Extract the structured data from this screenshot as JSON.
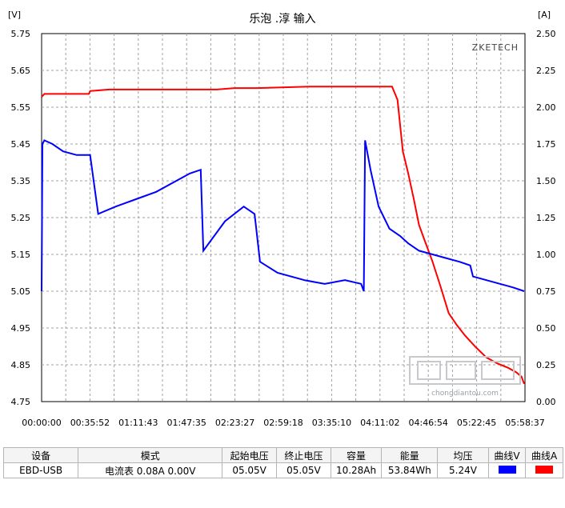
{
  "chart_data": {
    "type": "line",
    "title": "乐泡 .淳 输入",
    "brand": "ZKETECH",
    "left_axis": {
      "label": "[V]",
      "ylim": [
        4.75,
        5.75
      ],
      "ticks": [
        "5.75",
        "5.65",
        "5.55",
        "5.45",
        "5.35",
        "5.25",
        "5.15",
        "5.05",
        "4.95",
        "4.85",
        "4.75"
      ]
    },
    "right_axis": {
      "label": "[A]",
      "ylim": [
        0.0,
        2.5
      ],
      "ticks": [
        "2.50",
        "2.25",
        "2.00",
        "1.75",
        "1.50",
        "1.25",
        "1.00",
        "0.75",
        "0.50",
        "0.25",
        "0.00"
      ]
    },
    "x_ticks": [
      "00:00:00",
      "00:35:52",
      "01:11:43",
      "01:47:35",
      "02:23:27",
      "02:59:18",
      "03:35:10",
      "04:11:02",
      "04:46:54",
      "05:22:45",
      "05:58:37"
    ],
    "x_range_min": [
      0,
      358.6
    ],
    "grid": true,
    "series": [
      {
        "axis": "right",
        "color": "#ff0000",
        "points": [
          [
            0,
            2.07
          ],
          [
            2,
            2.09
          ],
          [
            10,
            2.09
          ],
          [
            20,
            2.09
          ],
          [
            35,
            2.09
          ],
          [
            36,
            2.11
          ],
          [
            50,
            2.12
          ],
          [
            80,
            2.12
          ],
          [
            110,
            2.12
          ],
          [
            130,
            2.12
          ],
          [
            143,
            2.13
          ],
          [
            160,
            2.13
          ],
          [
            200,
            2.14
          ],
          [
            240,
            2.14
          ],
          [
            260,
            2.14
          ],
          [
            264,
            2.05
          ],
          [
            268,
            1.7
          ],
          [
            272,
            1.55
          ],
          [
            276,
            1.38
          ],
          [
            280,
            1.2
          ],
          [
            284,
            1.1
          ],
          [
            290,
            0.95
          ],
          [
            296,
            0.78
          ],
          [
            302,
            0.6
          ],
          [
            308,
            0.52
          ],
          [
            314,
            0.45
          ],
          [
            322,
            0.37
          ],
          [
            330,
            0.3
          ],
          [
            338,
            0.26
          ],
          [
            346,
            0.23
          ],
          [
            352,
            0.2
          ],
          [
            356,
            0.17
          ],
          [
            358,
            0.12
          ]
        ]
      },
      {
        "axis": "left",
        "color": "#0000ff",
        "points": [
          [
            0,
            5.05
          ],
          [
            0.6,
            5.45
          ],
          [
            2,
            5.46
          ],
          [
            8,
            5.45
          ],
          [
            16,
            5.43
          ],
          [
            26,
            5.42
          ],
          [
            36,
            5.42
          ],
          [
            42,
            5.26
          ],
          [
            55,
            5.28
          ],
          [
            70,
            5.3
          ],
          [
            85,
            5.32
          ],
          [
            100,
            5.35
          ],
          [
            110,
            5.37
          ],
          [
            118,
            5.38
          ],
          [
            120,
            5.16
          ],
          [
            136,
            5.24
          ],
          [
            150,
            5.28
          ],
          [
            158,
            5.26
          ],
          [
            162,
            5.13
          ],
          [
            175,
            5.1
          ],
          [
            195,
            5.08
          ],
          [
            210,
            5.07
          ],
          [
            225,
            5.08
          ],
          [
            237,
            5.07
          ],
          [
            239,
            5.05
          ],
          [
            240,
            5.46
          ],
          [
            244,
            5.38
          ],
          [
            250,
            5.28
          ],
          [
            258,
            5.22
          ],
          [
            266,
            5.2
          ],
          [
            272,
            5.18
          ],
          [
            280,
            5.16
          ],
          [
            290,
            5.15
          ],
          [
            300,
            5.14
          ],
          [
            310,
            5.13
          ],
          [
            318,
            5.12
          ],
          [
            320,
            5.09
          ],
          [
            330,
            5.08
          ],
          [
            340,
            5.07
          ],
          [
            350,
            5.06
          ],
          [
            358,
            5.05
          ]
        ]
      }
    ]
  },
  "watermark": "chongdiantou.com",
  "table": {
    "headers": [
      "设备",
      "模式",
      "起始电压",
      "终止电压",
      "容量",
      "能量",
      "均压",
      "曲线V",
      "曲线A"
    ],
    "row": [
      "EBD-USB",
      "电流表  0.08A  0.00V",
      "05.05V",
      "05.05V",
      "10.28Ah",
      "53.84Wh",
      "5.24V",
      "",
      ""
    ]
  },
  "colors": {
    "voltage": "#0000ff",
    "current": "#ff0000",
    "grid": "#a0a0a0",
    "plot_bg": "#ffffff"
  }
}
